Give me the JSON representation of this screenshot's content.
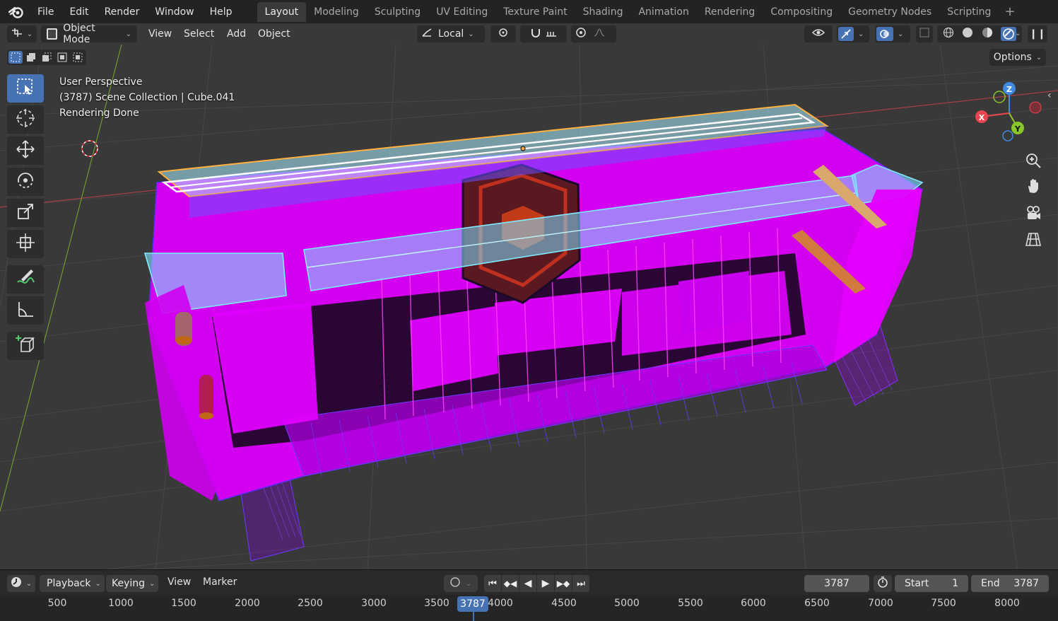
{
  "menu": {
    "items": [
      "File",
      "Edit",
      "Render",
      "Window",
      "Help"
    ]
  },
  "workspaces": {
    "tabs": [
      "Layout",
      "Modeling",
      "Sculpting",
      "UV Editing",
      "Texture Paint",
      "Shading",
      "Animation",
      "Rendering",
      "Compositing",
      "Geometry Nodes",
      "Scripting"
    ],
    "active": "Layout",
    "add_icon": "plus-icon"
  },
  "viewport_header": {
    "mode": "Object Mode",
    "menus": [
      "View",
      "Select",
      "Add",
      "Object"
    ],
    "transform_orientation": "Local",
    "options_label": "Options"
  },
  "viewport_info": {
    "perspective": "User Perspective",
    "collection": "(3787) Scene Collection | Cube.041",
    "status": "Rendering Done"
  },
  "gizmo": {
    "x_label": "X",
    "y_label": "Y",
    "z_label": "Z",
    "x_color": "#e8454f",
    "y_color": "#8ac52a",
    "z_color": "#3f8ae2"
  },
  "tools": [
    "select-box-icon",
    "cursor-icon",
    "move-icon",
    "rotate-icon",
    "scale-icon",
    "transform-icon",
    "annotate-icon",
    "measure-icon",
    "add-cube-icon"
  ],
  "nav": [
    "zoom-icon",
    "pan-hand-icon",
    "camera-icon",
    "grid-icon"
  ],
  "timeline": {
    "menus": [
      "Playback",
      "Keying",
      "View",
      "Marker"
    ],
    "current_frame": "3787",
    "start_label": "Start",
    "start_value": "1",
    "end_label": "End",
    "end_value": "3787",
    "ruler_ticks": [
      "500",
      "1000",
      "1500",
      "2000",
      "2500",
      "3000",
      "3500",
      "4000",
      "4500",
      "5000",
      "5500",
      "6000",
      "6500",
      "7000",
      "7500",
      "8000"
    ]
  },
  "colors": {
    "accent": "#4772b3",
    "magenta": "#ff00ff",
    "cyan": "#7fe9ff"
  }
}
